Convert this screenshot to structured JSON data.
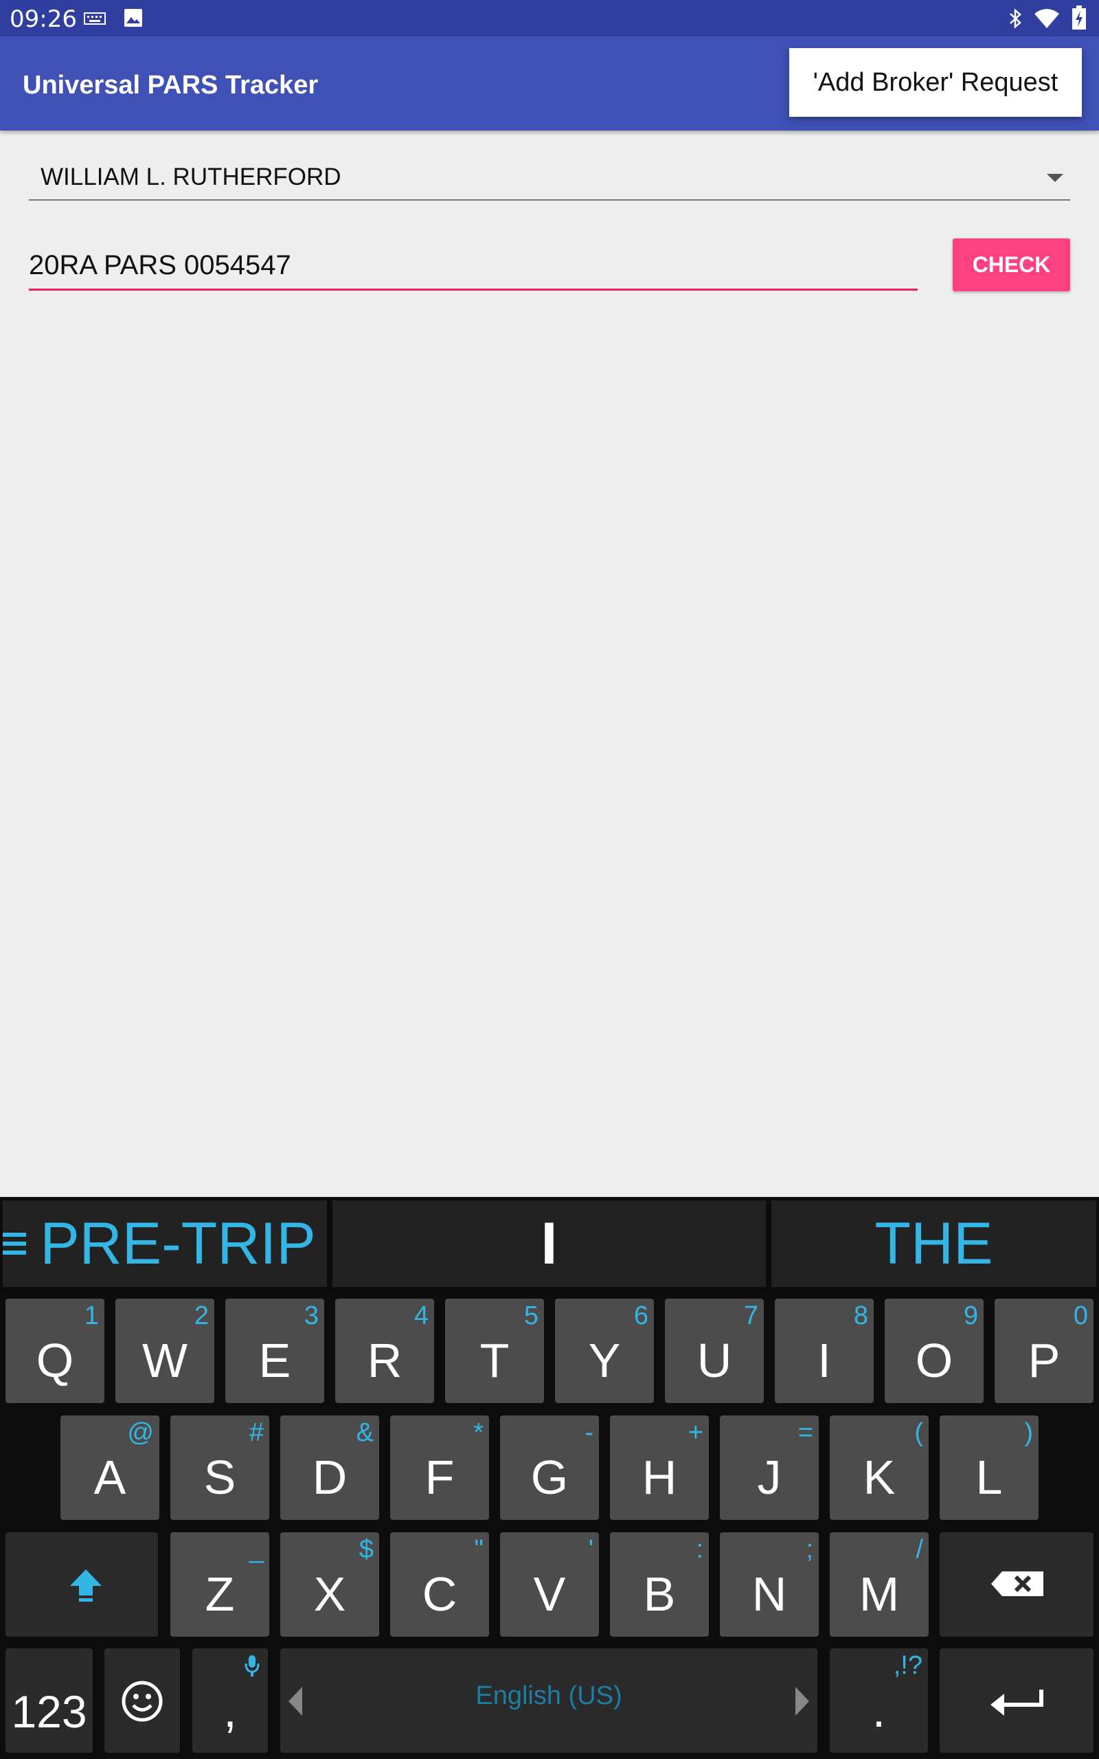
{
  "status_bar": {
    "time": "09:26"
  },
  "app_bar": {
    "title": "Universal PARS Tracker"
  },
  "menu": {
    "add_broker_label": "'Add Broker' Request"
  },
  "broker_spinner": {
    "value": "WILLIAM L. RUTHERFORD"
  },
  "pars_input": {
    "value": "20RA PARS 0054547"
  },
  "check_button": {
    "label": "CHECK"
  },
  "keyboard": {
    "suggestions": [
      "PRE-TRIP",
      "I",
      "THE"
    ],
    "row1": [
      {
        "key": "Q",
        "hint": "1"
      },
      {
        "key": "W",
        "hint": "2"
      },
      {
        "key": "E",
        "hint": "3"
      },
      {
        "key": "R",
        "hint": "4"
      },
      {
        "key": "T",
        "hint": "5"
      },
      {
        "key": "Y",
        "hint": "6"
      },
      {
        "key": "U",
        "hint": "7"
      },
      {
        "key": "I",
        "hint": "8"
      },
      {
        "key": "O",
        "hint": "9"
      },
      {
        "key": "P",
        "hint": "0"
      }
    ],
    "row2": [
      {
        "key": "A",
        "hint": "@"
      },
      {
        "key": "S",
        "hint": "#"
      },
      {
        "key": "D",
        "hint": "&"
      },
      {
        "key": "F",
        "hint": "*"
      },
      {
        "key": "G",
        "hint": "-"
      },
      {
        "key": "H",
        "hint": "+"
      },
      {
        "key": "J",
        "hint": "="
      },
      {
        "key": "K",
        "hint": "("
      },
      {
        "key": "L",
        "hint": ")"
      }
    ],
    "row3": [
      {
        "key": "Z",
        "hint": "_"
      },
      {
        "key": "X",
        "hint": "$"
      },
      {
        "key": "C",
        "hint": "\""
      },
      {
        "key": "V",
        "hint": "'"
      },
      {
        "key": "B",
        "hint": ":"
      },
      {
        "key": "N",
        "hint": ";"
      },
      {
        "key": "M",
        "hint": "/"
      }
    ],
    "numbers_label": "123",
    "comma_label": ",",
    "space_label": "English (US)",
    "period_label": ".",
    "period_hint": ",!?"
  },
  "colors": {
    "primary": "#3f51b5",
    "primary_dark": "#303f9f",
    "accent": "#ff4081",
    "keyboard_hint": "#33b5e5"
  }
}
